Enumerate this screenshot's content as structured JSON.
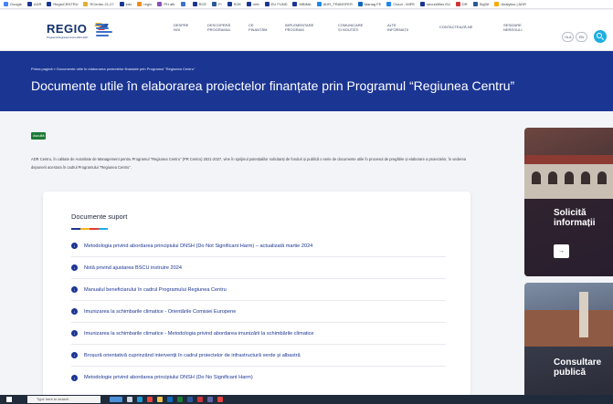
{
  "bookmarks": [
    {
      "label": "Google",
      "color": "#4285f4"
    },
    {
      "label": "ADR",
      "color": "#1b3593"
    },
    {
      "label": "RegioCENTRU",
      "color": "#1b3593"
    },
    {
      "label": "RCentru 21-27",
      "color": "#e3b02d"
    },
    {
      "label": "edo",
      "color": "#1b3593"
    },
    {
      "label": "regio",
      "color": "#f28b1f"
    },
    {
      "label": "PH afir",
      "color": "#8a4fb8"
    },
    {
      "label": "",
      "color": "#3d72c9"
    },
    {
      "label": "RCE",
      "color": "#1b3593"
    },
    {
      "label": "FI",
      "color": "#2b579a"
    },
    {
      "label": "SOK",
      "color": "#1b3593"
    },
    {
      "label": "mfe",
      "color": "#1b3593"
    },
    {
      "label": "EU FUND",
      "color": "#1b3593"
    },
    {
      "label": "MBIMA",
      "color": "#1b3593"
    },
    {
      "label": "ADR_TRANSFER",
      "color": "#1e88e5"
    },
    {
      "label": "Manag FE",
      "color": "#0a66c2"
    },
    {
      "label": "Cloud - MIPE",
      "color": "#1e88e5"
    },
    {
      "label": "securefiles EU",
      "color": "#1b3593"
    },
    {
      "label": "DR",
      "color": "#d13438"
    },
    {
      "label": "SigDif",
      "color": "#2b579a"
    },
    {
      "label": "Analytics | ADR",
      "color": "#f9ab00"
    }
  ],
  "header": {
    "logo_text": "REGIO",
    "logo_subtitle": "Programul Regiunea Centru 2021-2027",
    "nav": [
      {
        "line1": "Despre",
        "line2": "noi"
      },
      {
        "line1": "Descoperă",
        "line2": "programul"
      },
      {
        "line1": "Ce",
        "line2": "finanțăm"
      },
      {
        "line1": "Implementare",
        "line2": "program"
      },
      {
        "line1": "Comunicare",
        "line2": "și noutăți"
      },
      {
        "line1": "Alte",
        "line2": "informații"
      },
      {
        "line1": "Contactează-ne",
        "line2": ""
      },
      {
        "line1": "Sesizare",
        "line2": "nereguli"
      }
    ],
    "font_size_toggle": "+A-A",
    "language": "EN"
  },
  "banner": {
    "breadcrumb": "Prima pagină » Documente utile în elaborarea proiectelor finanțate prin Programul \"Regiunea Centru\"",
    "title": "Documente utile în elaborarea proiectelor finanțate prin Programul “Regiunea Centru”"
  },
  "content": {
    "badge": "Ascultă",
    "intro": "ADR Centru, în calitate de Autoritate de Management pentru Programul \"Regiunea Centru\" (PR Centru) 2021-2027, vine în sprijinul potențialilor solicitanți de fonduri și publică o serie de documente utile în procesul de pregătire și elaborare a proiectelor, în vederea depunerii acestora în cadrul Programului \"Regiunea Centru\".",
    "card_title": "Documente suport",
    "documents": [
      "Metodologia privind abordarea principiului DNSH (Do Not Significant Harm) – actualizată martie 2024",
      "Notă privind ajustarea BSCU instruire 2024",
      "Manualul beneficiarului în cadrul Programului Regiunea Centru",
      "Imunizarea la schimbarile climatice - Orientările Comisiei Europene",
      "Imunizarea la schimbarile climatice - Metodologia privind abordarea imunizării la schimbările climatice",
      "Broșură orientativă cuprinzând intervenții în cadrul proiectelor de infrastructură verde și albastră",
      "Metodologie privind abordarea principiului DNSH (Do No Significant Harm)"
    ]
  },
  "promos": [
    {
      "line1": "Solicită",
      "line2": "informații",
      "arrow": "→"
    },
    {
      "line1": "Consultare",
      "line2": "publică"
    }
  ],
  "taskbar": {
    "search_placeholder": "Type here to search"
  },
  "colors": {
    "brand_blue": "#1b3593",
    "accent_cyan": "#1eaee0",
    "badge_green": "#1d7a36"
  }
}
